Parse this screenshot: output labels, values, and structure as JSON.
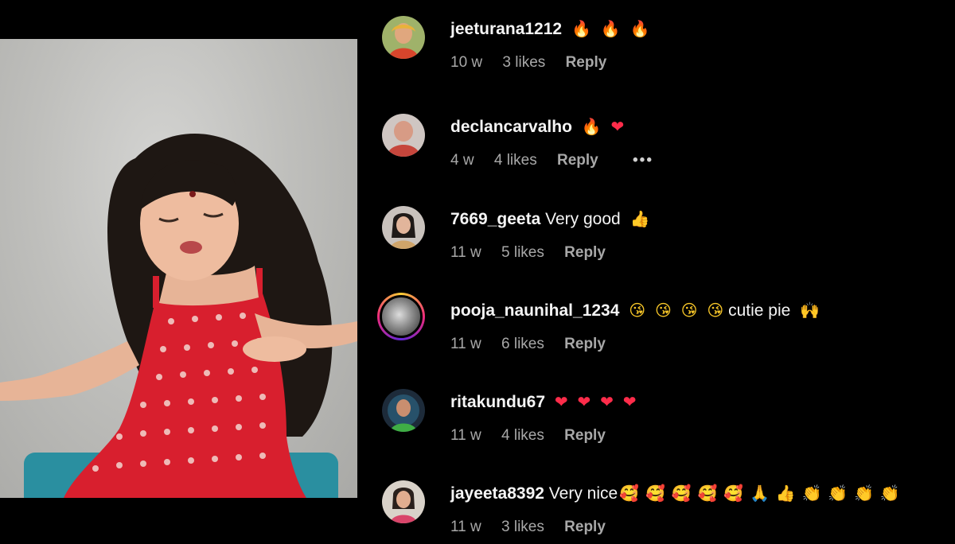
{
  "comments": [
    {
      "username": "jeeturana1212",
      "text": "",
      "emojis": [
        "🔥",
        "🔥",
        "🔥"
      ],
      "age": "10 w",
      "likes": "3 likes",
      "reply": "Reply"
    },
    {
      "username": "declancarvalho",
      "text": "",
      "emojis": [
        "🔥",
        "❤"
      ],
      "age": "4 w",
      "likes": "4 likes",
      "reply": "Reply",
      "more": "•••"
    },
    {
      "username": "7669_geeta",
      "text": "Very good",
      "emojis": [
        "👍"
      ],
      "age": "11 w",
      "likes": "5 likes",
      "reply": "Reply"
    },
    {
      "username": "pooja_naunihal_1234",
      "text": "cutie pie",
      "emojis": [
        "😘",
        "😘",
        "😘",
        "😘",
        "🙌"
      ],
      "age": "11 w",
      "likes": "6 likes",
      "reply": "Reply"
    },
    {
      "username": "ritakundu67",
      "text": "",
      "emojis": [
        "❤",
        "❤",
        "❤",
        "❤"
      ],
      "age": "11 w",
      "likes": "4 likes",
      "reply": "Reply"
    },
    {
      "username": "jayeeta8392",
      "text": "Very nice",
      "emojis": [
        "🥰",
        "🥰",
        "🥰",
        "🥰",
        "🥰",
        "🙏",
        "👍",
        "👏",
        "👏",
        "👏",
        "👏"
      ],
      "age": "11 w",
      "likes": "3 likes",
      "reply": "Reply"
    }
  ],
  "colors": {
    "background": "#000000",
    "primary_text": "#f5f5f5",
    "secondary_text": "#a8a8a8",
    "dress_red": "#d81f2e"
  }
}
